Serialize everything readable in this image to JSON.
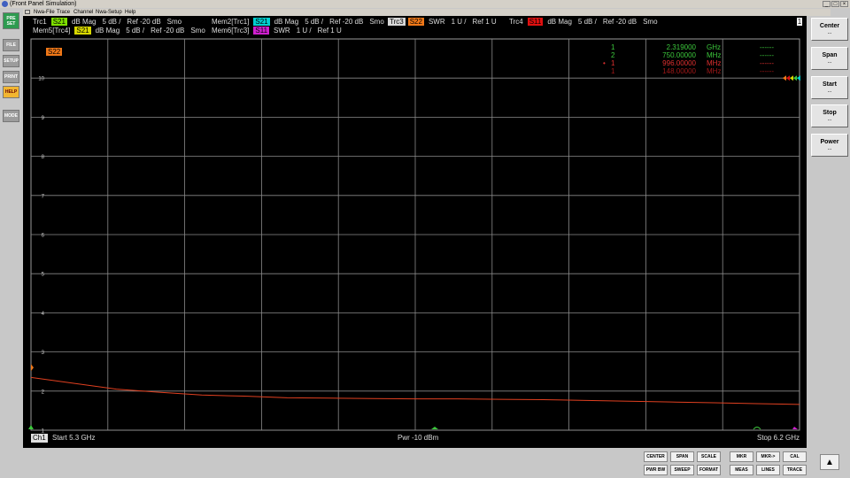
{
  "window": {
    "title": "(Front Panel Simulation)"
  },
  "menu": [
    "Nwa-File",
    "Trace",
    "Channel",
    "Nwa-Setup",
    "Help"
  ],
  "left_buttons": {
    "preset": "PRE SET",
    "file": "FILE",
    "setup": "SETUP",
    "print": "PRINT",
    "help": "HELP",
    "mode": "MODE"
  },
  "traces": {
    "row1": [
      {
        "name": "Trc1",
        "param": "S21",
        "param_color": "#7ee000",
        "fmt": "dB Mag",
        "scale": "5 dB /",
        "ref": "Ref -20 dB",
        "smo": "Smo"
      },
      {
        "name": "Mem2[Trc1]",
        "param": "S21",
        "param_color": "#00d0d0",
        "fmt": "dB Mag",
        "scale": "5 dB /",
        "ref": "Ref -20 dB",
        "smo": "Smo"
      },
      {
        "name": "Trc3",
        "param": "S22",
        "param_color": "#f07818",
        "fmt": "SWR",
        "scale": "1 U /",
        "ref": "Ref 1 U",
        "smo": ""
      },
      {
        "name": "Trc4",
        "param": "S11",
        "param_color": "#e01010",
        "fmt": "dB Mag",
        "scale": "5 dB /",
        "ref": "Ref -20 dB",
        "smo": "Smo"
      }
    ],
    "row2": [
      {
        "name": "Mem5[Trc4]",
        "param": "S21",
        "param_color": "#d8d800",
        "fmt": "dB Mag",
        "scale": "5 dB /",
        "ref": "Ref -20 dB",
        "smo": "Smo"
      },
      {
        "name": "Mem6[Trc3]",
        "param": "S11",
        "param_color": "#d020d0",
        "fmt": "SWR",
        "scale": "1 U /",
        "ref": "Ref 1 U",
        "smo": ""
      }
    ],
    "active_label": "S22",
    "corner_indicator": "1"
  },
  "markers": [
    {
      "bullet": "",
      "num": "1",
      "value": "2.319000",
      "unit": "GHz",
      "extra": "------",
      "color": "#3cc83c"
    },
    {
      "bullet": "",
      "num": "2",
      "value": "750.00000",
      "unit": "MHz",
      "extra": "------",
      "color": "#3cc83c"
    },
    {
      "bullet": "•",
      "num": "1",
      "value": "996.00000",
      "unit": "MHz",
      "extra": "------",
      "color": "#e03030"
    },
    {
      "bullet": "",
      "num": "1",
      "value": "148.00000",
      "unit": "MHz",
      "extra": "------",
      "color": "#a01818"
    }
  ],
  "chart_data": {
    "type": "line",
    "y_ticks": [
      10,
      9,
      8,
      7,
      6,
      5,
      4,
      3,
      2,
      1
    ],
    "ylim": [
      1,
      11
    ],
    "xlim": [
      5.3,
      6.2
    ],
    "x_unit": "GHz",
    "grid": true,
    "series": [
      {
        "color": "#e04020",
        "x": [
          5.3,
          5.35,
          5.4,
          5.45,
          5.5,
          5.55,
          5.6,
          5.65,
          5.7,
          5.75,
          5.8,
          5.85,
          5.9,
          5.95,
          6.0,
          6.05,
          6.1,
          6.15,
          6.2
        ],
        "y": [
          2.35,
          2.2,
          2.05,
          1.97,
          1.9,
          1.87,
          1.83,
          1.82,
          1.81,
          1.8,
          1.8,
          1.79,
          1.78,
          1.76,
          1.74,
          1.72,
          1.7,
          1.68,
          1.66
        ]
      }
    ]
  },
  "footer": {
    "channel": "Ch1",
    "start": "Start  5.3 GHz",
    "power": "Pwr  -10 dBm",
    "stop": "Stop  6.2 GHz"
  },
  "softkeys": [
    {
      "label": "Center",
      "sub": "..."
    },
    {
      "label": "Span",
      "sub": "..."
    },
    {
      "label": "Start",
      "sub": "..."
    },
    {
      "label": "Stop",
      "sub": "..."
    },
    {
      "label": "Power",
      "sub": "..."
    }
  ],
  "hardkeys": {
    "row1": [
      "CENTER",
      "SPAN",
      "SCALE",
      "MKR",
      "MKR->",
      "CAL"
    ],
    "row2": [
      "PWR BW",
      "SWEEP",
      "FORMAT",
      "MEAS",
      "LINES",
      "TRACE"
    ]
  },
  "up_arrow": "▲"
}
